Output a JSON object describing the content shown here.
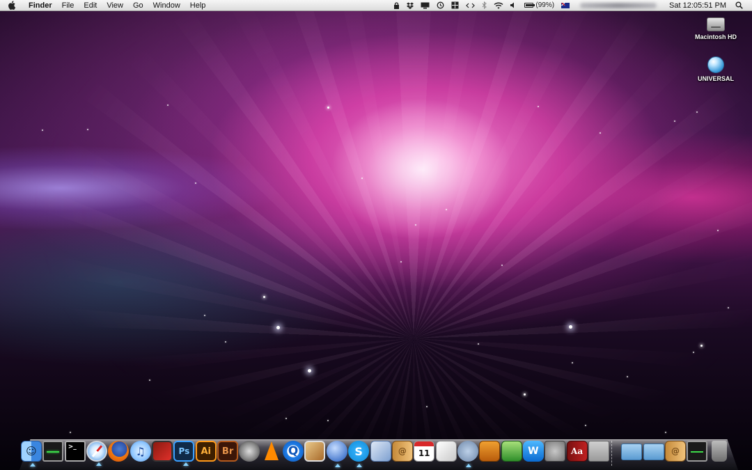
{
  "menubar": {
    "app_name": "Finder",
    "menus": [
      "File",
      "Edit",
      "View",
      "Go",
      "Window",
      "Help"
    ],
    "battery_percent": "(99%)",
    "battery_level": 0.99,
    "clock": "Sat 12:05:51 PM",
    "status_icons": [
      "lock-icon",
      "dropbox-icon",
      "display-icon",
      "time-machine-icon",
      "spaces-icon",
      "code-icon",
      "bluetooth-icon",
      "wifi-icon",
      "volume-icon",
      "battery-icon",
      "australia-flag-icon",
      "spotlight-icon"
    ]
  },
  "desktop": {
    "icons": [
      {
        "label": "Macintosh HD",
        "icon": "hard-drive-icon"
      },
      {
        "label": "UNIVERSAL",
        "icon": "disc-icon"
      }
    ]
  },
  "dock": {
    "apps": [
      {
        "name": "Finder",
        "glyph": "☺",
        "running": true
      },
      {
        "name": "Activity Monitor",
        "glyph": "",
        "running": false
      },
      {
        "name": "Terminal",
        "glyph": ">_",
        "running": false
      },
      {
        "name": "Safari",
        "glyph": "",
        "running": true
      },
      {
        "name": "Firefox",
        "glyph": "",
        "running": false
      },
      {
        "name": "iTunes",
        "glyph": "♫",
        "running": false
      },
      {
        "name": "Photo Booth",
        "glyph": "",
        "running": false
      },
      {
        "name": "Adobe Photoshop",
        "glyph": "Ps",
        "running": true
      },
      {
        "name": "Adobe Illustrator",
        "glyph": "Ai",
        "running": false
      },
      {
        "name": "Adobe Bridge",
        "glyph": "Br",
        "running": false
      },
      {
        "name": "DVD Player",
        "glyph": "",
        "running": false
      },
      {
        "name": "VLC",
        "glyph": "",
        "running": false
      },
      {
        "name": "QuickTime Player",
        "glyph": "Q",
        "running": false
      },
      {
        "name": "iPhoto",
        "glyph": "",
        "running": false
      },
      {
        "name": "iChat",
        "glyph": "",
        "running": true
      },
      {
        "name": "Skype",
        "glyph": "S",
        "running": true
      },
      {
        "name": "Mail",
        "glyph": "",
        "running": false
      },
      {
        "name": "Address Book",
        "glyph": "@",
        "running": false
      },
      {
        "name": "iCal",
        "glyph": "11",
        "running": false
      },
      {
        "name": "Preview",
        "glyph": "",
        "running": false
      },
      {
        "name": "Script Editor",
        "glyph": "",
        "running": true
      },
      {
        "name": "Keynote",
        "glyph": "",
        "running": false
      },
      {
        "name": "Numbers",
        "glyph": "",
        "running": false
      },
      {
        "name": "Word",
        "glyph": "W",
        "running": false
      },
      {
        "name": "System Preferences",
        "glyph": "",
        "running": false
      },
      {
        "name": "Dictionary",
        "glyph": "Aa",
        "running": false
      },
      {
        "name": "Calculator",
        "glyph": "",
        "running": false
      }
    ],
    "stacks": [
      {
        "name": "Applications folder",
        "glyph": ""
      },
      {
        "name": "Documents folder",
        "glyph": ""
      },
      {
        "name": "Contacts stack",
        "glyph": "@"
      },
      {
        "name": "Activity stack",
        "glyph": ""
      },
      {
        "name": "Trash",
        "glyph": ""
      }
    ]
  }
}
